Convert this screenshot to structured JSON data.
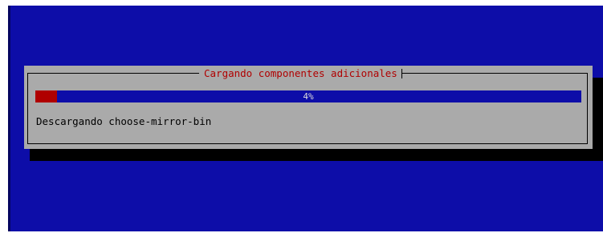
{
  "dialog": {
    "title": "Cargando componentes adicionales",
    "progress": {
      "percent": 4,
      "label": "4%"
    },
    "status": "Descargando choose-mirror-bin"
  },
  "colors": {
    "background": "#0d0da8",
    "dialog": "#aaaaaa",
    "accent": "#b00000",
    "shadow": "#000000"
  }
}
